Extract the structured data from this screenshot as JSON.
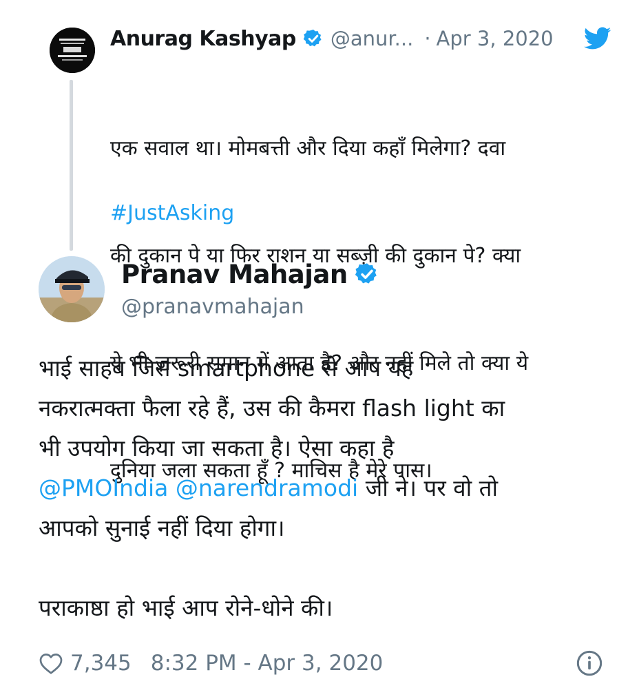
{
  "colors": {
    "accent": "#1da1f2",
    "text": "#14171a",
    "muted": "#657786",
    "thread_line": "#d4d9de"
  },
  "quoted_tweet": {
    "author_name": "Anurag Kashyap",
    "handle": "@anur...",
    "separator": "·",
    "date": "Apr 3, 2020",
    "verified": true,
    "text": "एक सवाल था। मोमबत्ती और दिया कहाँ मिलेगा? दवा की दुकान पे या फिर राशन या सब्ज़ी की दुकान पे? क्या ये भी ज़रूरी समान में आता है? और नहीं मिले तो क्या ये दुनिया जला सकता हूँ ? माचिस है मेरे पास।",
    "text_lines": [
      "एक सवाल था। मोमबत्ती और दिया कहाँ मिलेगा? दवा",
      "की दुकान पे या फिर राशन या सब्ज़ी की दुकान पे? क्या",
      "ये भी ज़रूरी समान में आता है? और नहीं मिले तो क्या ये",
      "दुनिया जला सकता हूँ ? माचिस है मेरे पास।"
    ],
    "hashtag": "#JustAsking"
  },
  "tweet": {
    "author_name": "Pranav Mahajan",
    "handle": "@pranavmahajan",
    "verified": true,
    "lines": [
      "भाई साहब जिस smartphone से आप यह",
      "नकरात्मक्ता फैला रहे हैं, उस की कैमरा flash light का",
      "भी उपयोग किया जा सकता है। ऐसा कहा है",
      "",
      "आपको सुनाई नहीं दिया होगा।",
      "",
      "पराकाष्ठा हो भाई आप रोने-धोने की।"
    ],
    "mention_1": "@PMOIndia",
    "mention_2": "@narendramodi",
    "after_mentions": " जी ने। पर वो तो",
    "like_count": "7,345",
    "timestamp": "8:32 PM - Apr 3, 2020"
  },
  "icons": {
    "brand": "twitter-bird-icon",
    "verified": "verified-badge-icon",
    "like": "heart-icon",
    "info": "info-icon"
  }
}
